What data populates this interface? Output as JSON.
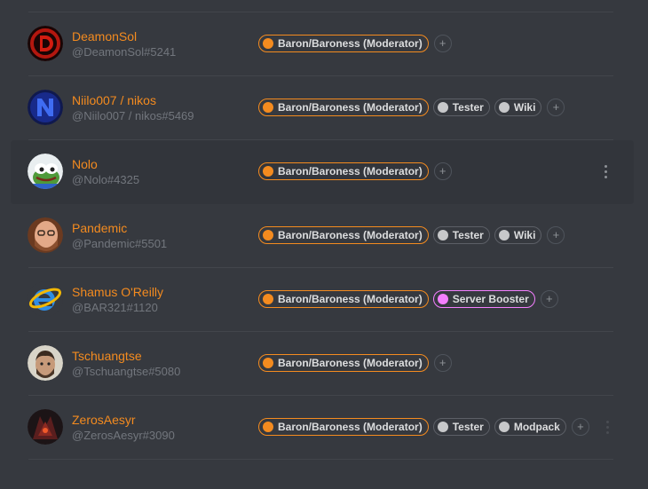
{
  "members": [
    {
      "name": "DeamonSol",
      "tag": "@DeamonSol#5241",
      "roles": [
        {
          "label": "Baron/Baroness (Moderator)",
          "color": "#f48b1f"
        }
      ]
    },
    {
      "name": "Niilo007 / nikos",
      "tag": "@Niilo007 / nikos#5469",
      "roles": [
        {
          "label": "Baron/Baroness (Moderator)",
          "color": "#f48b1f"
        },
        {
          "label": "Tester",
          "color": "#c7c8ca"
        },
        {
          "label": "Wiki",
          "color": "#c7c8ca"
        }
      ]
    },
    {
      "name": "Nolo",
      "tag": "@Nolo#4325",
      "roles": [
        {
          "label": "Baron/Baroness (Moderator)",
          "color": "#f48b1f"
        }
      ]
    },
    {
      "name": "Pandemic",
      "tag": "@Pandemic#5501",
      "roles": [
        {
          "label": "Baron/Baroness (Moderator)",
          "color": "#f48b1f"
        },
        {
          "label": "Tester",
          "color": "#c7c8ca"
        },
        {
          "label": "Wiki",
          "color": "#c7c8ca"
        }
      ]
    },
    {
      "name": "Shamus O'Reilly",
      "tag": "@BAR321#1120",
      "roles": [
        {
          "label": "Baron/Baroness (Moderator)",
          "color": "#f48b1f"
        },
        {
          "label": "Server Booster",
          "color": "#f47fff"
        }
      ]
    },
    {
      "name": "Tschuangtse",
      "tag": "@Tschuangtse#5080",
      "roles": [
        {
          "label": "Baron/Baroness (Moderator)",
          "color": "#f48b1f"
        }
      ]
    },
    {
      "name": "ZerosAesyr",
      "tag": "@ZerosAesyr#3090",
      "roles": [
        {
          "label": "Baron/Baroness (Moderator)",
          "color": "#f48b1f"
        },
        {
          "label": "Tester",
          "color": "#c7c8ca"
        },
        {
          "label": "Modpack",
          "color": "#c7c8ca"
        }
      ]
    }
  ],
  "add_role_label": "+",
  "colors": {
    "background": "#36393f",
    "hover_row": "#32353b",
    "username": "#f48b1f",
    "tag": "#72767d",
    "moderator": "#f48b1f",
    "booster": "#f47fff",
    "neutral_role": "#c7c8ca"
  },
  "icons": {
    "add": "plus-icon",
    "more": "vertical-ellipsis-icon"
  }
}
